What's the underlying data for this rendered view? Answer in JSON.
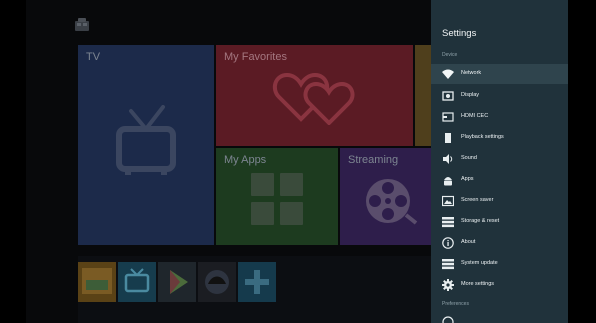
{
  "launcher": {
    "tiles": {
      "tv": "TV",
      "favorites": "My Favorites",
      "apps": "My Apps",
      "streaming": "Streaming"
    }
  },
  "settings": {
    "title": "Settings",
    "sections": {
      "device": "Device",
      "preferences": "Preferences"
    },
    "items": [
      {
        "label": "Network",
        "icon": "wifi-icon"
      },
      {
        "label": "Display",
        "icon": "display-icon"
      },
      {
        "label": "HDMI CEC",
        "icon": "hdmi-icon"
      },
      {
        "label": "Playback settings",
        "icon": "playback-icon"
      },
      {
        "label": "Sound",
        "icon": "speaker-icon"
      },
      {
        "label": "Apps",
        "icon": "android-icon"
      },
      {
        "label": "Screen saver",
        "icon": "screensaver-icon"
      },
      {
        "label": "Storage & reset",
        "icon": "storage-icon"
      },
      {
        "label": "About",
        "icon": "info-icon"
      },
      {
        "label": "System update",
        "icon": "system-update-icon"
      },
      {
        "label": "More settings",
        "icon": "gear-icon"
      }
    ],
    "selected": "Network"
  },
  "colors": {
    "panel_bg": "#20323b",
    "selected_bg": "#2f444d"
  }
}
